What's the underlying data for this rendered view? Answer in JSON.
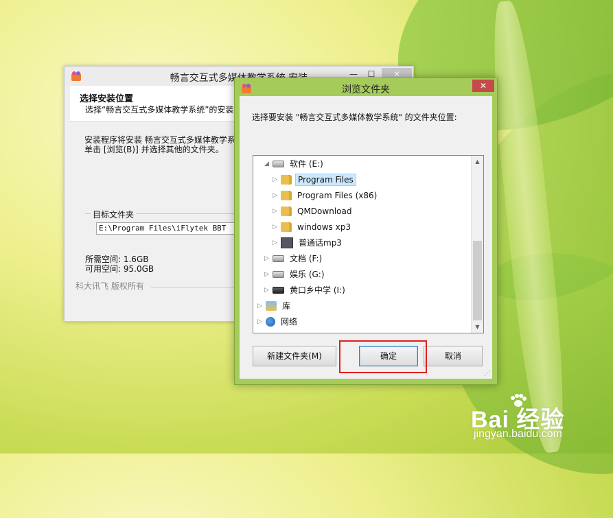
{
  "installer": {
    "title": "畅言交互式多媒体教学系统 安装",
    "controls": {
      "minimize": "—",
      "maximize": "☐",
      "close": "✕"
    },
    "header_title": "选择安装位置",
    "header_subtitle": "选择“畅言交互式多媒体教学系统”的安装",
    "description_line1": "安装程序将安装 畅言交互式多媒体教学系",
    "description_line2": "单击 [浏览(B)] 并选择其他的文件夹。",
    "target_group_label": "目标文件夹",
    "target_path": "E:\\Program Files\\iFlytek BBT",
    "space_required": "所需空间: 1.6GB",
    "space_available": "可用空间: 95.0GB",
    "footer": "科大讯飞 版权所有"
  },
  "dialog": {
    "title": "浏览文件夹",
    "close_label": "✕",
    "prompt": "选择要安装 \"畅言交互式多媒体教学系统\" 的文件夹位置:",
    "tree": [
      {
        "label": "软件 (E:)",
        "icon": "drive-icon",
        "expanded": true
      },
      {
        "label": "Program Files",
        "icon": "folder-icon",
        "selected": true
      },
      {
        "label": "Program Files (x86)",
        "icon": "folder-icon"
      },
      {
        "label": "QMDownload",
        "icon": "folder-icon"
      },
      {
        "label": "windows xp3",
        "icon": "folder-icon"
      },
      {
        "label": "普通话mp3",
        "icon": "media-folder-icon"
      },
      {
        "label": "文档 (F:)",
        "icon": "drive-icon"
      },
      {
        "label": "娱乐 (G:)",
        "icon": "drive-icon"
      },
      {
        "label": "黄口乡中学 (I:)",
        "icon": "removable-drive-icon"
      },
      {
        "label": "库",
        "icon": "library-icon"
      },
      {
        "label": "网络",
        "icon": "network-icon"
      }
    ],
    "buttons": {
      "new_folder": "新建文件夹(M)",
      "ok": "确定",
      "cancel": "取消"
    }
  },
  "watermark": {
    "brand": "Bai 经验",
    "url": "jingyan.baidu.com"
  },
  "colors": {
    "dialog_frame": "#a5cc5b",
    "highlight": "#e02020",
    "close_button": "#c74a4a",
    "selection": "#cce8ff"
  }
}
